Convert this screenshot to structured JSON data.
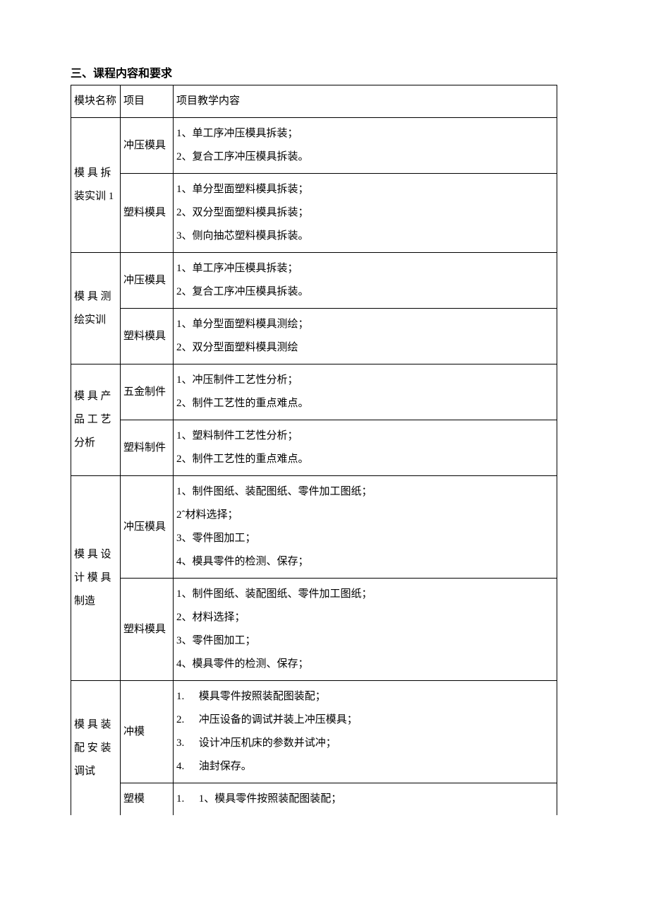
{
  "section_title": "三、课程内容和要求",
  "headers": {
    "module": "模块名称",
    "item": "项目",
    "content": "项目教学内容"
  },
  "modules": [
    {
      "name": "模 具 拆装实训 1",
      "rows": [
        {
          "item": "冲压模具",
          "lines": [
            "1、单工序冲压模具拆装；",
            "2、复合工序冲压模具拆装。"
          ]
        },
        {
          "item": "塑料模具",
          "lines": [
            "1、单分型面塑料模具拆装；",
            "2、双分型面塑料模具拆装；",
            "3、侧向抽芯塑料模具拆装。"
          ]
        }
      ]
    },
    {
      "name": "模 具 测绘实训",
      "rows": [
        {
          "item": "冲压模具",
          "lines": [
            "1、单工序冲压模具拆装；",
            "2、复合工序冲压模具拆装。"
          ]
        },
        {
          "item": "塑料模具",
          "lines": [
            "1、单分型面塑料模具测绘；",
            "2、双分型面塑料模具测绘"
          ]
        }
      ]
    },
    {
      "name": "模 具 产品 工 艺分析",
      "rows": [
        {
          "item": "五金制件",
          "lines": [
            "1、冲压制件工艺性分析；",
            "2、制件工艺性的重点难点。"
          ]
        },
        {
          "item": "塑料制件",
          "lines": [
            "1、塑料制件工艺性分析；",
            "2、制件工艺性的重点难点。"
          ]
        }
      ]
    },
    {
      "name": "模 具 设计 模 具制造",
      "rows": [
        {
          "item": "冲压模具",
          "lines": [
            "1、制件图纸、装配图纸、零件加工图纸；",
            "2ˆ材料选择；",
            "3、零件图加工；",
            "4、模具零件的检测、保存；"
          ]
        },
        {
          "item": "塑料模具",
          "lines": [
            "1、制件图纸、装配图纸、零件加工图纸；",
            "2、材料选择；",
            "3、零件图加工；",
            "4、模具零件的检测、保存；"
          ]
        }
      ]
    },
    {
      "name": "模 具 装配 安 装调试",
      "rows": [
        {
          "item": "冲模",
          "ordered": true,
          "lines": [
            "模具零件按照装配图装配；",
            "冲压设备的调试并装上冲压模具；",
            "设计冲压机床的参数并试冲；",
            "油封保存。"
          ]
        },
        {
          "item": "塑模",
          "ordered": true,
          "lines": [
            "1、模具零件按照装配图装配；"
          ],
          "open_bottom": true
        }
      ]
    }
  ]
}
